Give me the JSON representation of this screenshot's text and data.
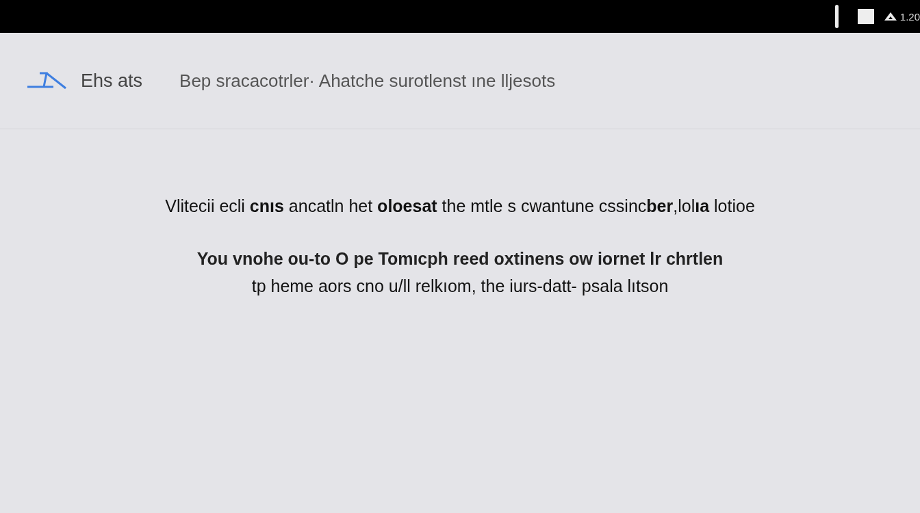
{
  "top_bar": {
    "clock": "1.20"
  },
  "header": {
    "title": "Ehs ats",
    "subtitle": "Bep sracacotrler· Ahatche surotlenst ıne lljesots"
  },
  "message": {
    "headline": "Vlitecii ecli **cnıs** ancatln het **oloesat** the mtle s cwantune cssinc**ber**,lol**ıa** lotioe",
    "lines": [
      "You vnohe ou-to O pe Tomıcph reed oxtinens ow iornet lr chrtlen",
      "tp heme aors cno u/ll relkıom, the iurs-datt- psala lıtson"
    ]
  }
}
